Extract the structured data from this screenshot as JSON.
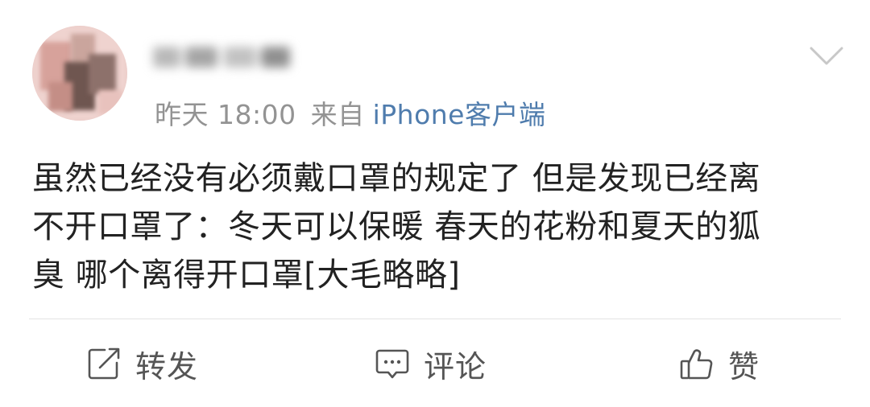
{
  "post": {
    "username_label": "",
    "time": "昨天 18:00",
    "source_prefix": "来自",
    "source_client": "iPhone客户端",
    "content": "虽然已经没有必须戴口罩的规定了 但是发现已经离\n不开口罩了：冬天可以保暖 春天的花粉和夏天的狐\n臭 哪个离得开口罩[大毛略略]"
  },
  "icons": {
    "menu": "chevron-down-icon",
    "repost": "edit-share-icon",
    "comment": "comment-bubble-icon",
    "like": "thumbs-up-icon"
  },
  "actions": {
    "repost_label": "转发",
    "comment_label": "评论",
    "like_label": "赞"
  },
  "colors": {
    "link": "#4f7cad",
    "meta": "#939393",
    "text": "#222222",
    "action": "#555555"
  }
}
